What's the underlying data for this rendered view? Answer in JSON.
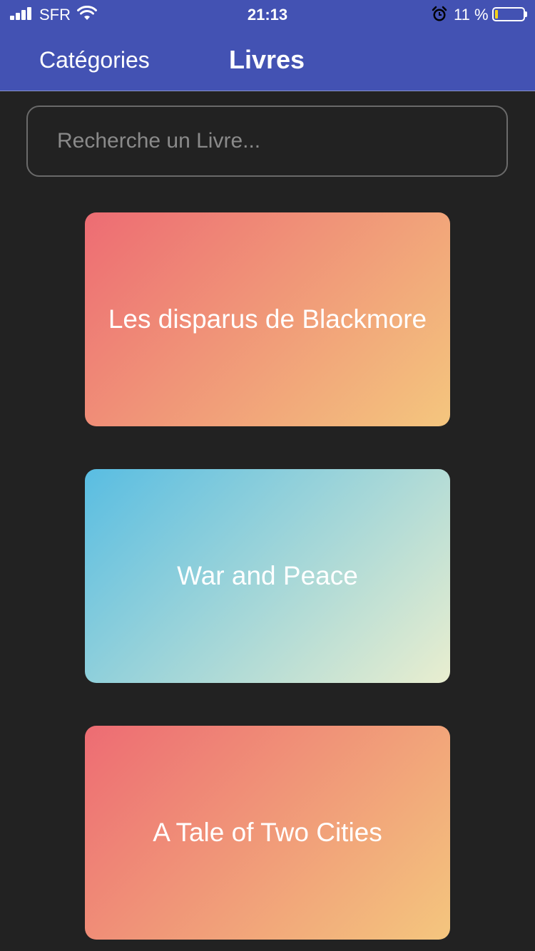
{
  "status_bar": {
    "carrier": "SFR",
    "time": "21:13",
    "battery_percent": "11 %",
    "battery_level": 0.11,
    "battery_fill_color": "#f2d21a",
    "icons": [
      "signal-icon",
      "wifi-icon",
      "alarm-icon",
      "battery-icon"
    ]
  },
  "header": {
    "background_color": "#4352b3",
    "tabs": [
      {
        "label": "Catégories",
        "active": false
      },
      {
        "label": "Livres",
        "active": true
      }
    ]
  },
  "search": {
    "placeholder": "Recherche un Livre...",
    "value": ""
  },
  "books": [
    {
      "title": "Les disparus de Blackmore",
      "gradient": [
        "#ed6c73",
        "#f4c67e"
      ]
    },
    {
      "title": "War and Peace",
      "gradient": [
        "#59bde2",
        "#e9eecf"
      ]
    },
    {
      "title": "A Tale of Two Cities",
      "gradient": [
        "#ed6c73",
        "#f4c67e"
      ]
    }
  ]
}
